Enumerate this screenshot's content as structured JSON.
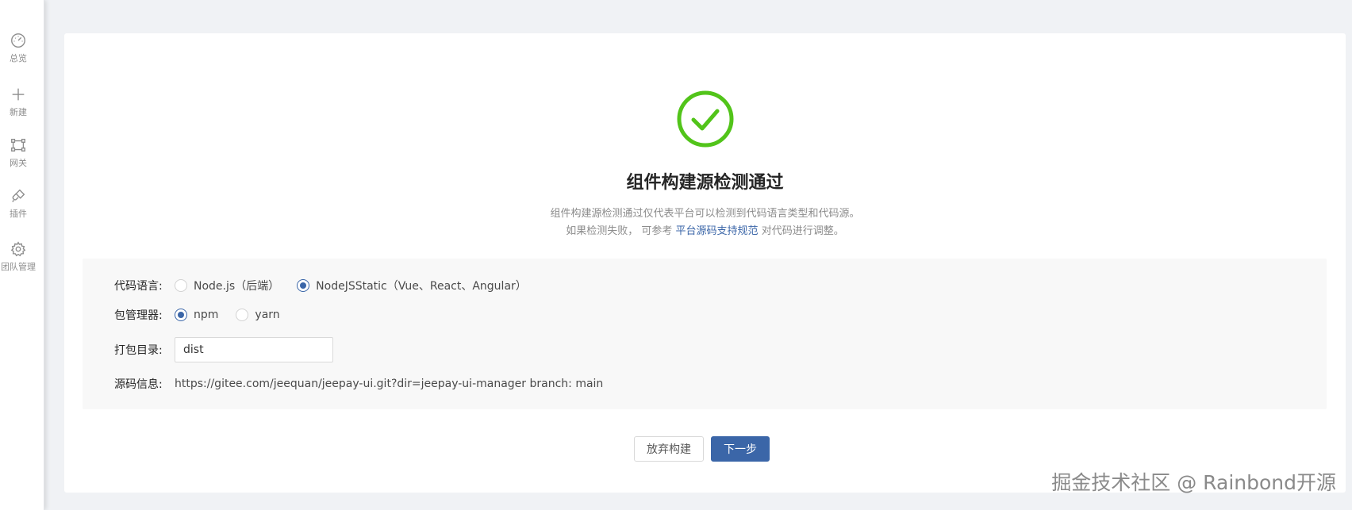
{
  "sidebar": {
    "items": [
      {
        "label": "总览",
        "icon": "dashboard-icon"
      },
      {
        "label": "新建",
        "icon": "plus-icon"
      },
      {
        "label": "网关",
        "icon": "gateway-icon"
      },
      {
        "label": "插件",
        "icon": "plugin-icon"
      },
      {
        "label": "团队管理",
        "icon": "gear-icon"
      }
    ]
  },
  "result": {
    "icon": "check-circle-icon",
    "icon_color": "#52c41a",
    "title": "组件构建源检测通过",
    "desc_line1": "组件构建源检测通过仅代表平台可以检测到代码语言类型和代码源。",
    "desc_line2_prefix": "如果检测失败， 可参考 ",
    "desc_link": "平台源码支持规范",
    "desc_line2_suffix": " 对代码进行调整。"
  },
  "form": {
    "language": {
      "label": "代码语言:",
      "options": [
        {
          "text": "Node.js（后端）",
          "checked": false
        },
        {
          "text": "NodeJSStatic（Vue、React、Angular）",
          "checked": true
        }
      ]
    },
    "package_manager": {
      "label": "包管理器:",
      "options": [
        {
          "text": "npm",
          "checked": true
        },
        {
          "text": "yarn",
          "checked": false
        }
      ]
    },
    "build_dir": {
      "label": "打包目录:",
      "value": "dist"
    },
    "source": {
      "label": "源码信息:",
      "value": "https://gitee.com/jeequan/jeepay-ui.git?dir=jeepay-ui-manager branch: main"
    }
  },
  "actions": {
    "cancel_label": "放弃构建",
    "next_label": "下一步",
    "primary_color": "#3b66a8"
  },
  "watermark": "掘金技术社区 @ Rainbond开源"
}
